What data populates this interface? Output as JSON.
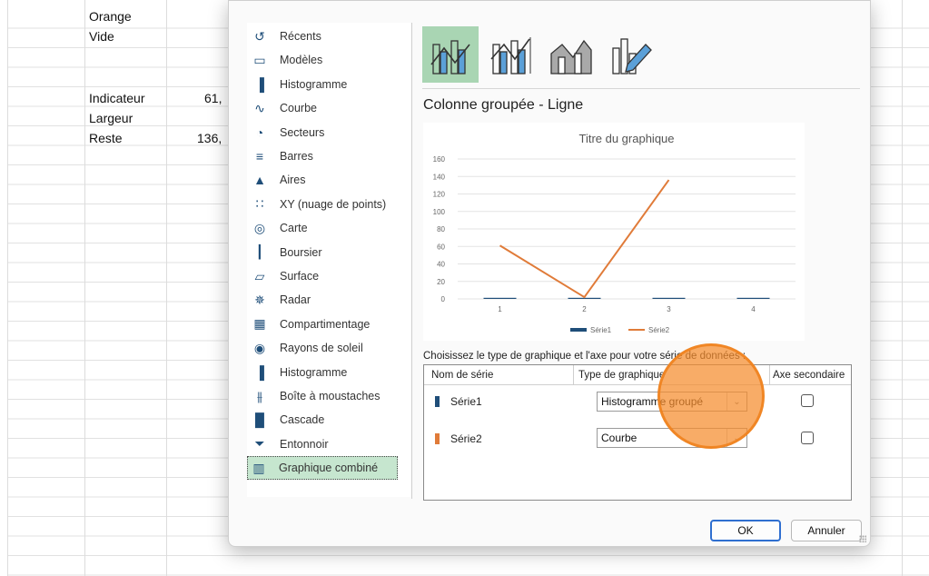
{
  "sheet": {
    "cells": [
      {
        "id": "a1",
        "text": "Orange"
      },
      {
        "id": "a2",
        "text": "Vide"
      },
      {
        "id": "a5",
        "text": "Indicateur"
      },
      {
        "id": "b5",
        "text": "61,"
      },
      {
        "id": "a6",
        "text": "Largeur"
      },
      {
        "id": "a7",
        "text": "Reste"
      },
      {
        "id": "b7",
        "text": "136,"
      }
    ]
  },
  "dialog": {
    "chart_types": [
      {
        "label": "Récents",
        "icon": "recent-icon"
      },
      {
        "label": "Modèles",
        "icon": "folder-icon"
      },
      {
        "label": "Histogramme",
        "icon": "column-chart-icon"
      },
      {
        "label": "Courbe",
        "icon": "line-chart-icon"
      },
      {
        "label": "Secteurs",
        "icon": "pie-chart-icon"
      },
      {
        "label": "Barres",
        "icon": "bar-chart-icon"
      },
      {
        "label": "Aires",
        "icon": "area-chart-icon"
      },
      {
        "label": "XY (nuage de points)",
        "icon": "scatter-chart-icon"
      },
      {
        "label": "Carte",
        "icon": "map-chart-icon"
      },
      {
        "label": "Boursier",
        "icon": "stock-chart-icon"
      },
      {
        "label": "Surface",
        "icon": "surface-chart-icon"
      },
      {
        "label": "Radar",
        "icon": "radar-chart-icon"
      },
      {
        "label": "Compartimentage",
        "icon": "treemap-chart-icon"
      },
      {
        "label": "Rayons de soleil",
        "icon": "sunburst-chart-icon"
      },
      {
        "label": "Histogramme",
        "icon": "histogram-chart-icon"
      },
      {
        "label": "Boîte à moustaches",
        "icon": "box-whisker-icon"
      },
      {
        "label": "Cascade",
        "icon": "waterfall-chart-icon"
      },
      {
        "label": "Entonnoir",
        "icon": "funnel-chart-icon"
      },
      {
        "label": "Graphique combiné",
        "icon": "combo-chart-icon",
        "selected": true
      }
    ],
    "subtype_title": "Colonne groupée - Ligne",
    "choose_label": "Choisissez le type de graphique et l'axe pour votre série de données :",
    "table_headers": {
      "name": "Nom de série",
      "type": "Type de graphique",
      "secondary": "Axe secondaire"
    },
    "series": [
      {
        "name": "Série1",
        "chart_type": "Histogramme groupé",
        "color": "#1f4e79",
        "secondary": false
      },
      {
        "name": "Série2",
        "chart_type": "Courbe",
        "color": "#e07b39",
        "secondary": false
      }
    ],
    "buttons": {
      "ok": "OK",
      "cancel": "Annuler"
    },
    "accent": "#a9d5b3"
  },
  "chart_data": {
    "type": "bar",
    "title": "Titre du graphique",
    "categories": [
      "1",
      "2",
      "3",
      "4"
    ],
    "ylim": [
      0,
      160
    ],
    "yticks": [
      0,
      20,
      40,
      60,
      80,
      100,
      120,
      140,
      160
    ],
    "series": [
      {
        "name": "Série1",
        "type": "bar",
        "color": "#1f4e79",
        "values": [
          0,
          0,
          0,
          1
        ]
      },
      {
        "name": "Série2",
        "type": "line",
        "color": "#e07b39",
        "values": [
          61,
          2,
          136,
          null
        ]
      }
    ],
    "legend": "bottom",
    "grid": true
  }
}
